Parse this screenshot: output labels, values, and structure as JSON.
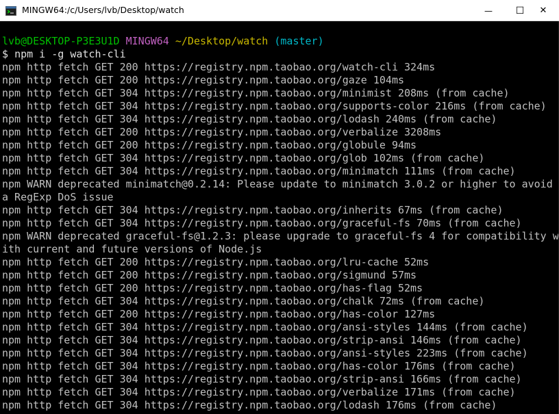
{
  "window": {
    "title": "MINGW64:/c/Users/lvb/Desktop/watch",
    "icon": "mingw-terminal-icon",
    "minimize_glyph": "—",
    "maximize_glyph": "☐",
    "close_glyph": "✕"
  },
  "prompt": {
    "user_host": "lvb@DESKTOP-P3E3U1D",
    "system": "MINGW64",
    "path": "~/Desktop/watch",
    "branch": "(master)",
    "symbol": "$",
    "command": "npm i -g watch-cli"
  },
  "output": [
    "npm http fetch GET 200 https://registry.npm.taobao.org/watch-cli 324ms",
    "npm http fetch GET 200 https://registry.npm.taobao.org/gaze 104ms",
    "npm http fetch GET 304 https://registry.npm.taobao.org/minimist 208ms (from cache)",
    "npm http fetch GET 304 https://registry.npm.taobao.org/supports-color 216ms (from cache)",
    "npm http fetch GET 304 https://registry.npm.taobao.org/lodash 240ms (from cache)",
    "npm http fetch GET 200 https://registry.npm.taobao.org/verbalize 3208ms",
    "npm http fetch GET 200 https://registry.npm.taobao.org/globule 94ms",
    "npm http fetch GET 304 https://registry.npm.taobao.org/glob 102ms (from cache)",
    "npm http fetch GET 304 https://registry.npm.taobao.org/minimatch 111ms (from cache)",
    "npm WARN deprecated minimatch@0.2.14: Please update to minimatch 3.0.2 or higher to avoid",
    "a RegExp DoS issue",
    "npm http fetch GET 304 https://registry.npm.taobao.org/inherits 67ms (from cache)",
    "npm http fetch GET 304 https://registry.npm.taobao.org/graceful-fs 70ms (from cache)",
    "npm WARN deprecated graceful-fs@1.2.3: please upgrade to graceful-fs 4 for compatibility w",
    "ith current and future versions of Node.js",
    "npm http fetch GET 200 https://registry.npm.taobao.org/lru-cache 52ms",
    "npm http fetch GET 200 https://registry.npm.taobao.org/sigmund 57ms",
    "npm http fetch GET 200 https://registry.npm.taobao.org/has-flag 52ms",
    "npm http fetch GET 304 https://registry.npm.taobao.org/chalk 72ms (from cache)",
    "npm http fetch GET 200 https://registry.npm.taobao.org/has-color 127ms",
    "npm http fetch GET 304 https://registry.npm.taobao.org/ansi-styles 144ms (from cache)",
    "npm http fetch GET 304 https://registry.npm.taobao.org/strip-ansi 146ms (from cache)",
    "npm http fetch GET 304 https://registry.npm.taobao.org/ansi-styles 223ms (from cache)",
    "npm http fetch GET 304 https://registry.npm.taobao.org/has-color 176ms (from cache)",
    "npm http fetch GET 304 https://registry.npm.taobao.org/strip-ansi 166ms (from cache)",
    "npm http fetch GET 304 https://registry.npm.taobao.org/verbalize 171ms (from cache)",
    "npm http fetch GET 304 https://registry.npm.taobao.org/lodash 176ms (from cache)"
  ],
  "colors": {
    "user_host": "#00c000",
    "system": "#c060c0",
    "path": "#c8b800",
    "branch": "#00b8c8",
    "output_text": "#c0c0c0",
    "background": "#000000"
  }
}
